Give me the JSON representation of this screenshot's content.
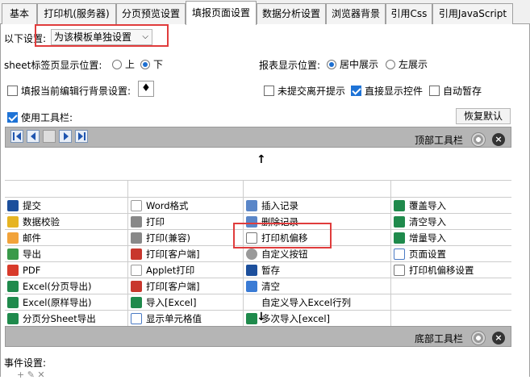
{
  "tabs": [
    {
      "label": "基本"
    },
    {
      "label": "打印机(服务器)"
    },
    {
      "label": "分页预览设置"
    },
    {
      "label": "填报页面设置"
    },
    {
      "label": "数据分析设置"
    },
    {
      "label": "浏览器背景"
    },
    {
      "label": "引用Css"
    },
    {
      "label": "引用JavaScript"
    }
  ],
  "settings": {
    "scope_label": "以下设置:",
    "scope_value": "为该模板单独设置",
    "sheet_tab_label": "sheet标签页显示位置:",
    "sheet_top": "上",
    "sheet_bottom": "下",
    "report_pos_label": "报表显示位置:",
    "center": "居中展示",
    "left": "左展示",
    "fill_bg_label": "填报当前编辑行背景设置:",
    "unsubmitted_label": "未提交离开提示",
    "direct_show_label": "直接显示控件",
    "auto_save_label": "自动暂存",
    "use_toolbar_label": "使用工具栏:",
    "restore_default": "恢复默认",
    "top_toolbar": "顶部工具栏",
    "bottom_toolbar": "底部工具栏",
    "event_settings": "事件设置:"
  },
  "grid": {
    "col1": [
      "提交",
      "数据校验",
      "邮件",
      "导出",
      "PDF",
      "Excel(分页导出)",
      "Excel(原样导出)",
      "分页分Sheet导出"
    ],
    "col2": [
      "Word格式",
      "打印",
      "打印(兼容)",
      "打印[客户端]",
      "Applet打印",
      "打印[客户端]",
      "导入[Excel]",
      "显示单元格值"
    ],
    "col3": [
      "插入记录",
      "删除记录",
      "打印机偏移",
      "自定义按钮",
      "暂存",
      "清空",
      "自定义导入Excel行列",
      "多次导入[excel]"
    ],
    "col4": [
      "覆盖导入",
      "清空导入",
      "增量导入",
      "页面设置",
      "打印机偏移设置",
      "",
      "",
      ""
    ]
  },
  "colors": {
    "highlight": "#e03c3c",
    "accent": "#1e73d6"
  }
}
